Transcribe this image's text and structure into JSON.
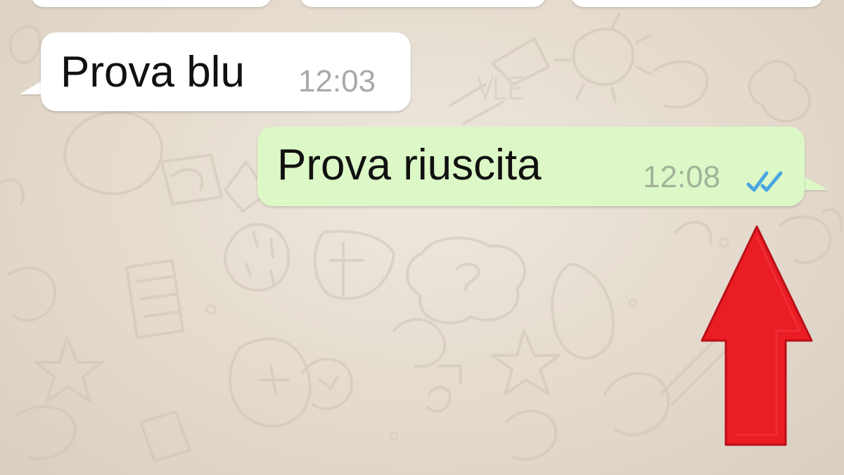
{
  "chat": {
    "messages": [
      {
        "direction": "incoming",
        "text": "Prova blu",
        "time": "12:03"
      },
      {
        "direction": "outgoing",
        "text": "Prova riuscita",
        "time": "12:08",
        "status_icon": "double-check-read-icon",
        "status_color": "#4aa6df"
      }
    ]
  },
  "colors": {
    "background": "#e8dfd3",
    "incoming_bubble": "#ffffff",
    "outgoing_bubble": "#dcf8c6",
    "timestamp": "#a7aaa7",
    "annotation_arrow": "#ea1c24"
  },
  "annotation": {
    "icon": "red-up-arrow-icon",
    "points_to": "double-check-read-icon"
  }
}
